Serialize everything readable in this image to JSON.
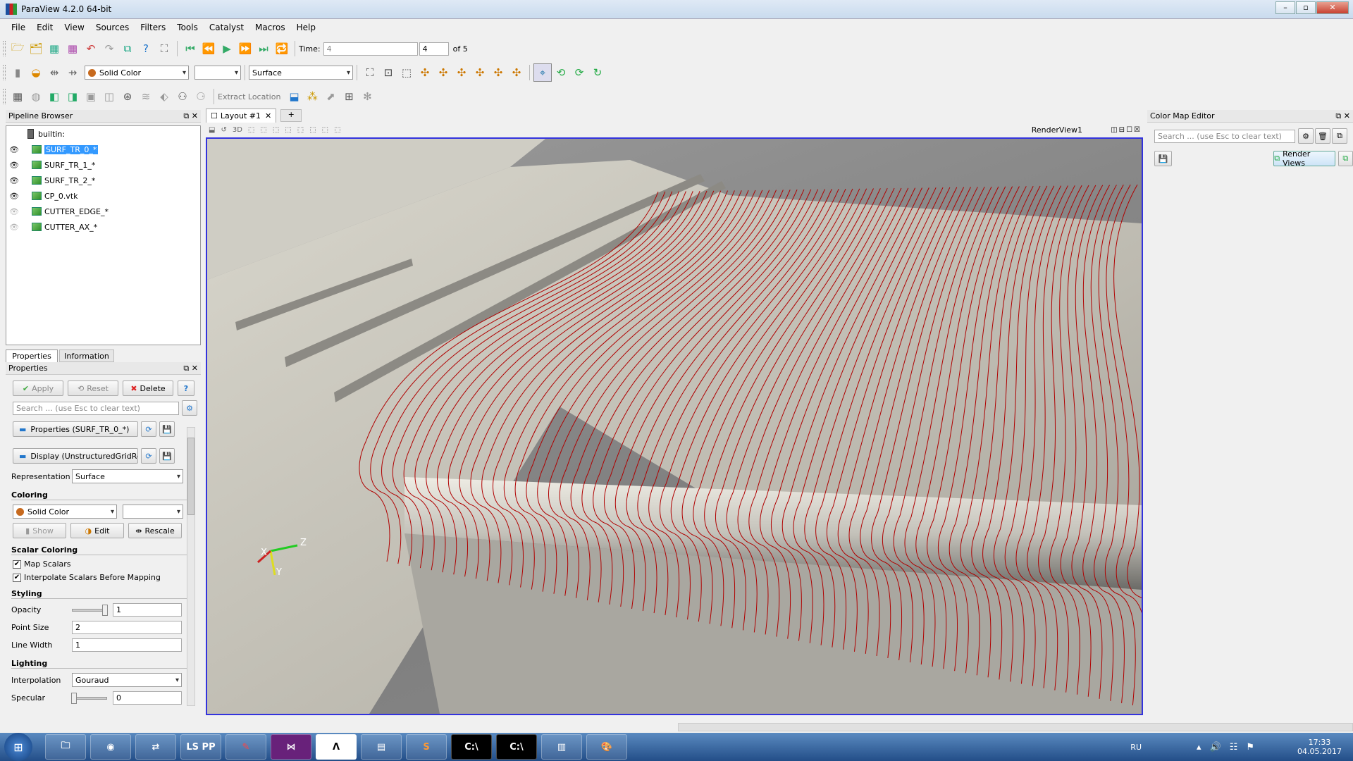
{
  "window": {
    "title": "ParaView 4.2.0 64-bit"
  },
  "menu": [
    "File",
    "Edit",
    "View",
    "Sources",
    "Filters",
    "Tools",
    "Catalyst",
    "Macros",
    "Help"
  ],
  "time": {
    "label": "Time:",
    "value": "4",
    "index": "4",
    "of_label": "of 5"
  },
  "toolbar2": {
    "coloring": "Solid Color",
    "representation": "Surface"
  },
  "toolbar3": {
    "extract_location": "Extract Location"
  },
  "pipeline": {
    "title": "Pipeline Browser",
    "root": "builtin:",
    "items": [
      {
        "label": "SURF_TR_0_*",
        "visible": true
      },
      {
        "label": "SURF_TR_1_*",
        "visible": true
      },
      {
        "label": "SURF_TR_2_*",
        "visible": true
      },
      {
        "label": "CP_0.vtk",
        "visible": true
      },
      {
        "label": "CUTTER_EDGE_*",
        "visible": false
      },
      {
        "label": "CUTTER_AX_*",
        "visible": false
      }
    ]
  },
  "tabs": {
    "properties": "Properties",
    "information": "Information"
  },
  "props": {
    "title": "Properties",
    "apply": "Apply",
    "reset": "Reset",
    "delete": "Delete",
    "search_placeholder": "Search ... (use Esc to clear text)",
    "properties_group": "Properties (SURF_TR_0_*)",
    "display_group": "Display (UnstructuredGridRe",
    "representation_label": "Representation",
    "representation": "Surface",
    "coloring_section": "Coloring",
    "coloring": "Solid Color",
    "show": "Show",
    "edit": "Edit",
    "rescale": "Rescale",
    "scalar_section": "Scalar Coloring",
    "map_scalars": "Map Scalars",
    "interpolate_scalars": "Interpolate Scalars Before Mapping",
    "styling_section": "Styling",
    "opacity_label": "Opacity",
    "opacity": "1",
    "point_size_label": "Point Size",
    "point_size": "2",
    "line_width_label": "Line Width",
    "line_width": "1",
    "lighting_section": "Lighting",
    "interpolation_label": "Interpolation",
    "interpolation": "Gouraud",
    "specular_label": "Specular",
    "specular": "0"
  },
  "layout": {
    "tab": "Layout #1",
    "add": "+",
    "render_view": "RenderView1",
    "mode_3d": "3D"
  },
  "axes": {
    "x": "X",
    "y": "Y",
    "z": "Z"
  },
  "colormap": {
    "title": "Color Map Editor",
    "search_placeholder": "Search ... (use Esc to clear text)",
    "render_views": "Render Views"
  },
  "taskbar": {
    "lang": "RU",
    "time": "17:33",
    "date": "04.05.2017",
    "lspp": "LS PP"
  },
  "colors": {
    "selection": "#3399ff",
    "viewport_border": "#3333dd",
    "curves": "#b00000"
  }
}
